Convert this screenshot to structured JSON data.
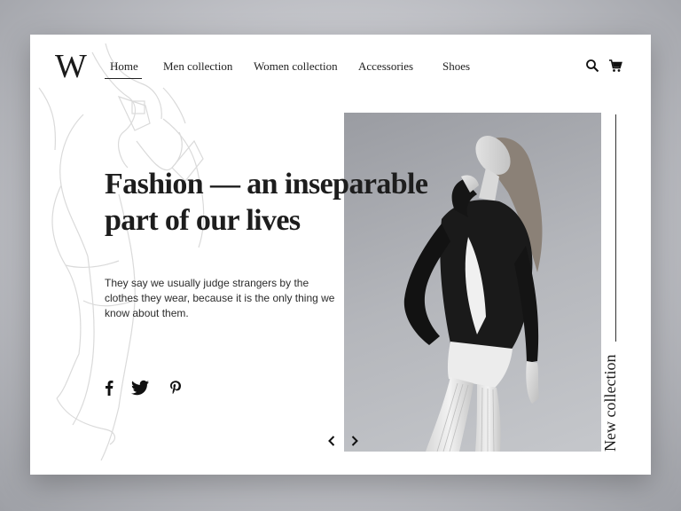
{
  "logo": {
    "text": "W"
  },
  "nav": {
    "items": [
      {
        "label": "Home",
        "active": true
      },
      {
        "label": "Men collection",
        "active": false
      },
      {
        "label": "Women collection",
        "active": false
      },
      {
        "label": "Accessories",
        "active": false
      },
      {
        "label": "Shoes",
        "active": false
      }
    ],
    "icons": [
      "search-icon",
      "cart-icon"
    ]
  },
  "hero": {
    "headline_line1": "Fashion — an inseparable",
    "headline_line2": "part of our lives",
    "body": "They say we usually judge strangers by the clothes they wear, because it is the only thing we know about them.",
    "side_label": "New collection"
  },
  "social": [
    "facebook-icon",
    "twitter-icon",
    "pinterest-icon"
  ],
  "carousel": {
    "prev_icon": "chevron-left-icon",
    "next_icon": "chevron-right-icon"
  },
  "colors": {
    "text": "#1d1d1d",
    "background": "#ffffff",
    "sketch": "#d9d9d9"
  }
}
